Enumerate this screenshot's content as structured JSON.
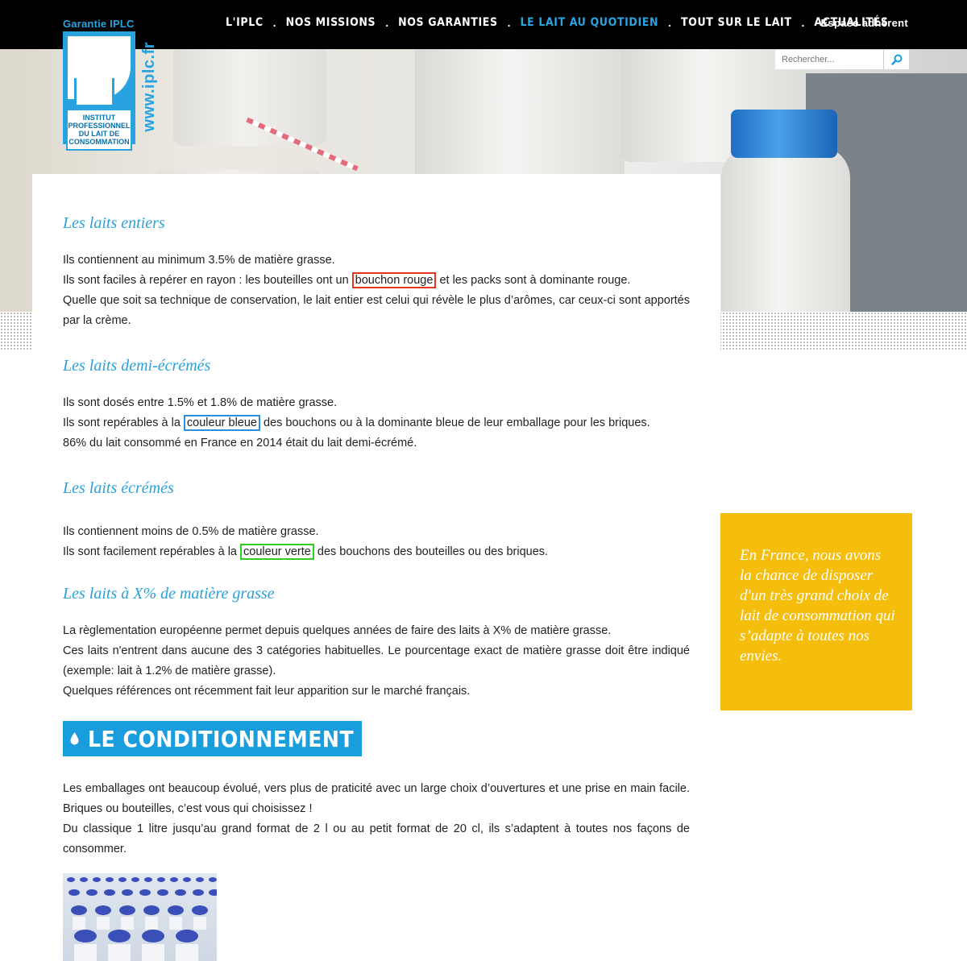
{
  "header": {
    "nav": [
      {
        "label": "L'IPLC",
        "active": false
      },
      {
        "label": "NOS MISSIONS",
        "active": false
      },
      {
        "label": "NOS GARANTIES",
        "active": false
      },
      {
        "label": "LE LAIT AU QUOTIDIEN",
        "active": true
      },
      {
        "label": "TOUT SUR LE LAIT",
        "active": false
      },
      {
        "label": "ACTUALITÉS",
        "active": false
      }
    ],
    "separator": ".",
    "member_link": "Espace adhérent"
  },
  "logo": {
    "top_text": "Garantie IPLC",
    "box_text": "INSTITUT PROFESSIONNEL DU LAIT DE CONSOMMATION",
    "url_text": "www.iplc.fr"
  },
  "search": {
    "placeholder": "Rechercher..."
  },
  "sections": {
    "entiers": {
      "title": "Les laits entiers",
      "line1": "Ils contiennent au minimum 3.5% de matière grasse.",
      "line2_before": "Ils sont faciles à repérer en rayon : les bouteilles ont un ",
      "line2_highlight": "bouchon rouge",
      "line2_after": " et les packs sont à dominante rouge.",
      "line3": "Quelle que soit sa technique de conservation, le lait entier est celui qui révèle le plus d’arômes, car ceux-ci sont apportés par la crème."
    },
    "demi": {
      "title": "Les laits demi-écrémés",
      "line1": "Ils sont dosés entre 1.5% et 1.8% de matière grasse.",
      "line2_before": "Ils sont repérables à la ",
      "line2_highlight": "couleur bleue",
      "line2_after": " des bouchons ou à la dominante bleue de leur emballage pour les briques.",
      "line3": "86% du lait consommé en France en 2014 était du lait demi-écrémé."
    },
    "ecremes": {
      "title": "Les laits écrémés",
      "line1": "Ils contiennent moins de 0.5% de matière grasse.",
      "line2_before": "Ils sont facilement repérables à la ",
      "line2_highlight": "couleur verte",
      "line2_after": " des bouchons des bouteilles ou des briques."
    },
    "xpercent": {
      "title": "Les laits à X% de matière grasse",
      "line1": "La règlementation européenne permet depuis quelques années de faire des laits à X% de matière grasse.",
      "line2": "Ces laits n'entrent dans aucune des 3 catégories habituelles. Le pourcentage exact de matière grasse doit être indiqué (exemple: lait à 1.2% de matière grasse).",
      "line3": "Quelques références ont récemment fait leur apparition sur le marché français."
    }
  },
  "conditionnement": {
    "banner": "LE CONDITIONNEMENT",
    "para1": "Les emballages ont beaucoup évolué, vers plus de praticité avec un large choix d’ouvertures et une prise en main facile. Briques ou bouteilles, c’est vous qui choisissez !",
    "para2": "Du classique 1 litre jusqu’au grand format de 2 l ou au petit format de 20 cl, ils s’adaptent à toutes nos façons de consommer."
  },
  "quote": {
    "text": "En France, nous avons la chance de disposer d'un très grand choix de lait de consommation qui s’adapte à toutes nos envies."
  },
  "colors": {
    "accent_blue": "#2aa1db",
    "quote_yellow": "#f5be0c",
    "highlight_red": "#e4361e",
    "highlight_blue": "#2a8fe0",
    "highlight_green": "#2fce22"
  }
}
